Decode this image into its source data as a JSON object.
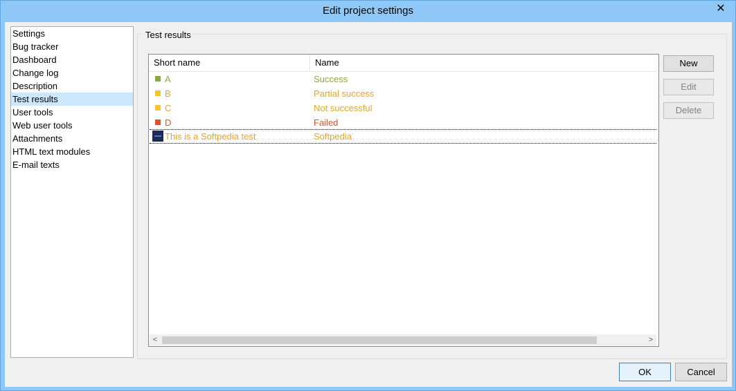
{
  "window": {
    "title": "Edit project settings",
    "close_glyph": "✕"
  },
  "sidebar": {
    "items": [
      {
        "label": "Settings"
      },
      {
        "label": "Bug tracker"
      },
      {
        "label": "Dashboard"
      },
      {
        "label": "Change log"
      },
      {
        "label": "Description"
      },
      {
        "label": "Test results",
        "selected": true
      },
      {
        "label": "User tools"
      },
      {
        "label": "Web user tools"
      },
      {
        "label": "Attachments"
      },
      {
        "label": "HTML text modules"
      },
      {
        "label": "E-mail texts"
      }
    ]
  },
  "test_results": {
    "group_label": "Test results",
    "columns": [
      "Short name",
      "Name"
    ],
    "rows": [
      {
        "short": "A",
        "name": "Success",
        "color": "#8aab3c",
        "icon": "square-swatch"
      },
      {
        "short": "B",
        "name": "Partial success",
        "color": "#e0a829",
        "icon": "square-swatch"
      },
      {
        "short": "C",
        "name": "Not successful",
        "color": "#e0a829",
        "icon": "square-swatch"
      },
      {
        "short": "D",
        "name": "Failed",
        "color": "#d2552e",
        "icon": "square-swatch"
      },
      {
        "short": "This is a Softpedia test",
        "name": "Softpedia",
        "color": "#e0a829",
        "icon": "dark-blue-image-icon"
      }
    ],
    "scroll_left_glyph": "<",
    "scroll_right_glyph": ">"
  },
  "actions": {
    "new": "New",
    "edit": "Edit",
    "delete": "Delete"
  },
  "footer": {
    "ok": "OK",
    "cancel": "Cancel"
  }
}
